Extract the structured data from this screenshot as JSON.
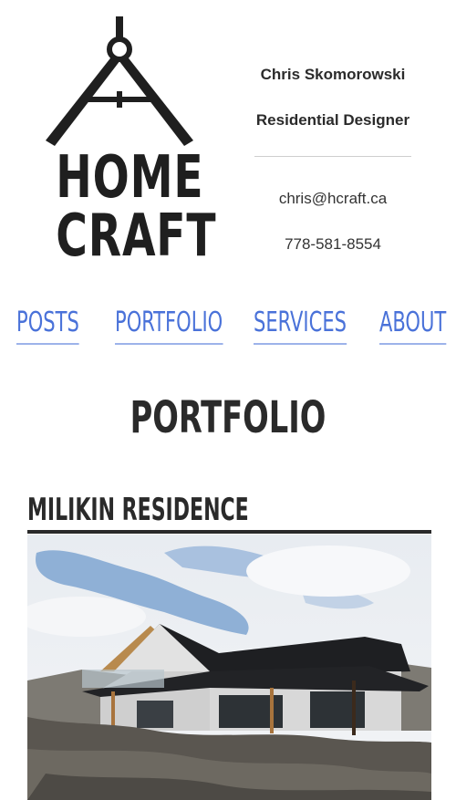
{
  "header": {
    "logo": {
      "line1": "HOME",
      "line2": "CRAFT"
    },
    "contact": {
      "name": "Chris Skomorowski",
      "title": "Residential Designer",
      "email": "chris@hcraft.ca",
      "phone": "778-581-8554"
    }
  },
  "nav": {
    "items": [
      {
        "label": "POSTS"
      },
      {
        "label": "PORTFOLIO"
      },
      {
        "label": "SERVICES"
      },
      {
        "label": "ABOUT"
      }
    ]
  },
  "main": {
    "page_title": "PORTFOLIO",
    "posts": [
      {
        "title": "MILIKIN RESIDENCE"
      }
    ]
  },
  "colors": {
    "nav_link": "#4a72d9",
    "text_dark": "#2a2a2a",
    "background": "#ffffff"
  }
}
